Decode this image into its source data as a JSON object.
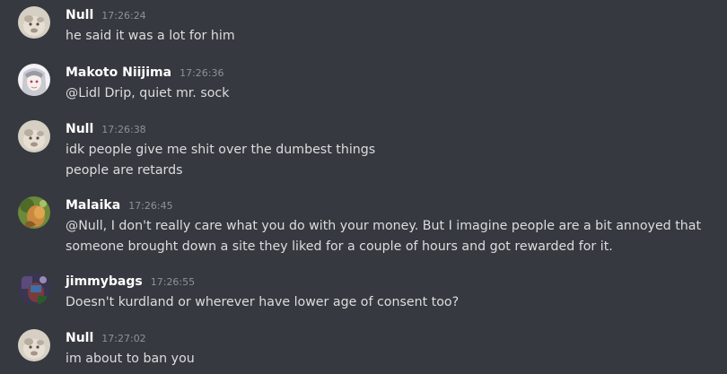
{
  "messages": [
    {
      "avatar": "null-avatar-icon",
      "username": "Null",
      "timestamp": "17:26:24",
      "lines": [
        "he said it was a lot for him"
      ]
    },
    {
      "avatar": "makoto-avatar-icon",
      "username": "Makoto Niijima",
      "timestamp": "17:26:36",
      "lines": [
        "@Lidl Drip, quiet mr. sock"
      ]
    },
    {
      "avatar": "null-avatar-icon",
      "username": "Null",
      "timestamp": "17:26:38",
      "lines": [
        "idk people give me shit over the dumbest things",
        "people are retards"
      ]
    },
    {
      "avatar": "malaika-avatar-icon",
      "username": "Malaika",
      "timestamp": "17:26:45",
      "lines": [
        "@Null, I don't really care what you do with your money. But I imagine people are a bit annoyed that",
        "someone brought down a site they liked for a couple of hours and got rewarded for it."
      ]
    },
    {
      "avatar": "jimmybags-avatar-icon",
      "username": "jimmybags",
      "timestamp": "17:26:55",
      "lines": [
        "Doesn't kurdland or wherever have lower age of consent too?"
      ]
    },
    {
      "avatar": "null-avatar-icon",
      "username": "Null",
      "timestamp": "17:27:02",
      "lines": [
        "im about to ban you"
      ]
    }
  ],
  "colors": {
    "background": "#36393f",
    "username": "#ffffff",
    "timestamp": "#8e9297",
    "text": "#dcddde"
  }
}
